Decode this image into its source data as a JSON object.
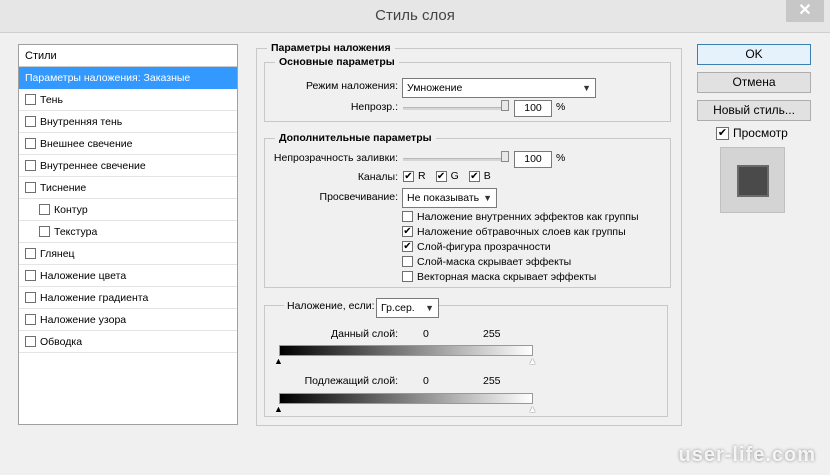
{
  "window": {
    "title": "Стиль слоя",
    "close_glyph": "✕"
  },
  "styles_panel": {
    "header": "Стили",
    "items": [
      {
        "label": "Параметры наложения: Заказные",
        "checkbox": false,
        "selected": true
      },
      {
        "label": "Тень",
        "checkbox": true,
        "checked": false
      },
      {
        "label": "Внутренняя тень",
        "checkbox": true,
        "checked": false
      },
      {
        "label": "Внешнее свечение",
        "checkbox": true,
        "checked": false
      },
      {
        "label": "Внутреннее свечение",
        "checkbox": true,
        "checked": false
      },
      {
        "label": "Тиснение",
        "checkbox": true,
        "checked": false
      },
      {
        "label": "Контур",
        "checkbox": true,
        "checked": false,
        "sub": true
      },
      {
        "label": "Текстура",
        "checkbox": true,
        "checked": false,
        "sub": true
      },
      {
        "label": "Глянец",
        "checkbox": true,
        "checked": false
      },
      {
        "label": "Наложение цвета",
        "checkbox": true,
        "checked": false
      },
      {
        "label": "Наложение градиента",
        "checkbox": true,
        "checked": false
      },
      {
        "label": "Наложение узора",
        "checkbox": true,
        "checked": false
      },
      {
        "label": "Обводка",
        "checkbox": true,
        "checked": false
      }
    ]
  },
  "blending": {
    "title": "Параметры наложения",
    "general": {
      "title": "Основные параметры",
      "mode_label": "Режим наложения:",
      "mode_value": "Умножение",
      "opacity_label": "Непрозр.:",
      "opacity_value": "100",
      "pct": "%"
    },
    "advanced": {
      "title": "Дополнительные параметры",
      "fill_label": "Непрозрачность заливки:",
      "fill_value": "100",
      "pct": "%",
      "channels_label": "Каналы:",
      "channels": [
        {
          "label": "R",
          "checked": true
        },
        {
          "label": "G",
          "checked": true
        },
        {
          "label": "B",
          "checked": true
        }
      ],
      "knockout_label": "Просвечивание:",
      "knockout_value": "Не показывать",
      "options": [
        {
          "label": "Наложение внутренних эффектов как группы",
          "checked": false
        },
        {
          "label": "Наложение обтравочных слоев как группы",
          "checked": true
        },
        {
          "label": "Слой-фигура прозрачности",
          "checked": true
        },
        {
          "label": "Слой-маска скрывает эффекты",
          "checked": false
        },
        {
          "label": "Векторная маска скрывает эффекты",
          "checked": false
        }
      ]
    },
    "blend_if": {
      "label": "Наложение, если:",
      "value": "Гр.сер.",
      "this_layer_label": "Данный слой:",
      "this_layer_min": "0",
      "this_layer_max": "255",
      "underlying_label": "Подлежащий слой:",
      "underlying_min": "0",
      "underlying_max": "255"
    }
  },
  "buttons": {
    "ok": "OK",
    "cancel": "Отмена",
    "new_style": "Новый стиль...",
    "preview_label": "Просмотр",
    "preview_checked": true
  },
  "watermark": "user-life.com"
}
